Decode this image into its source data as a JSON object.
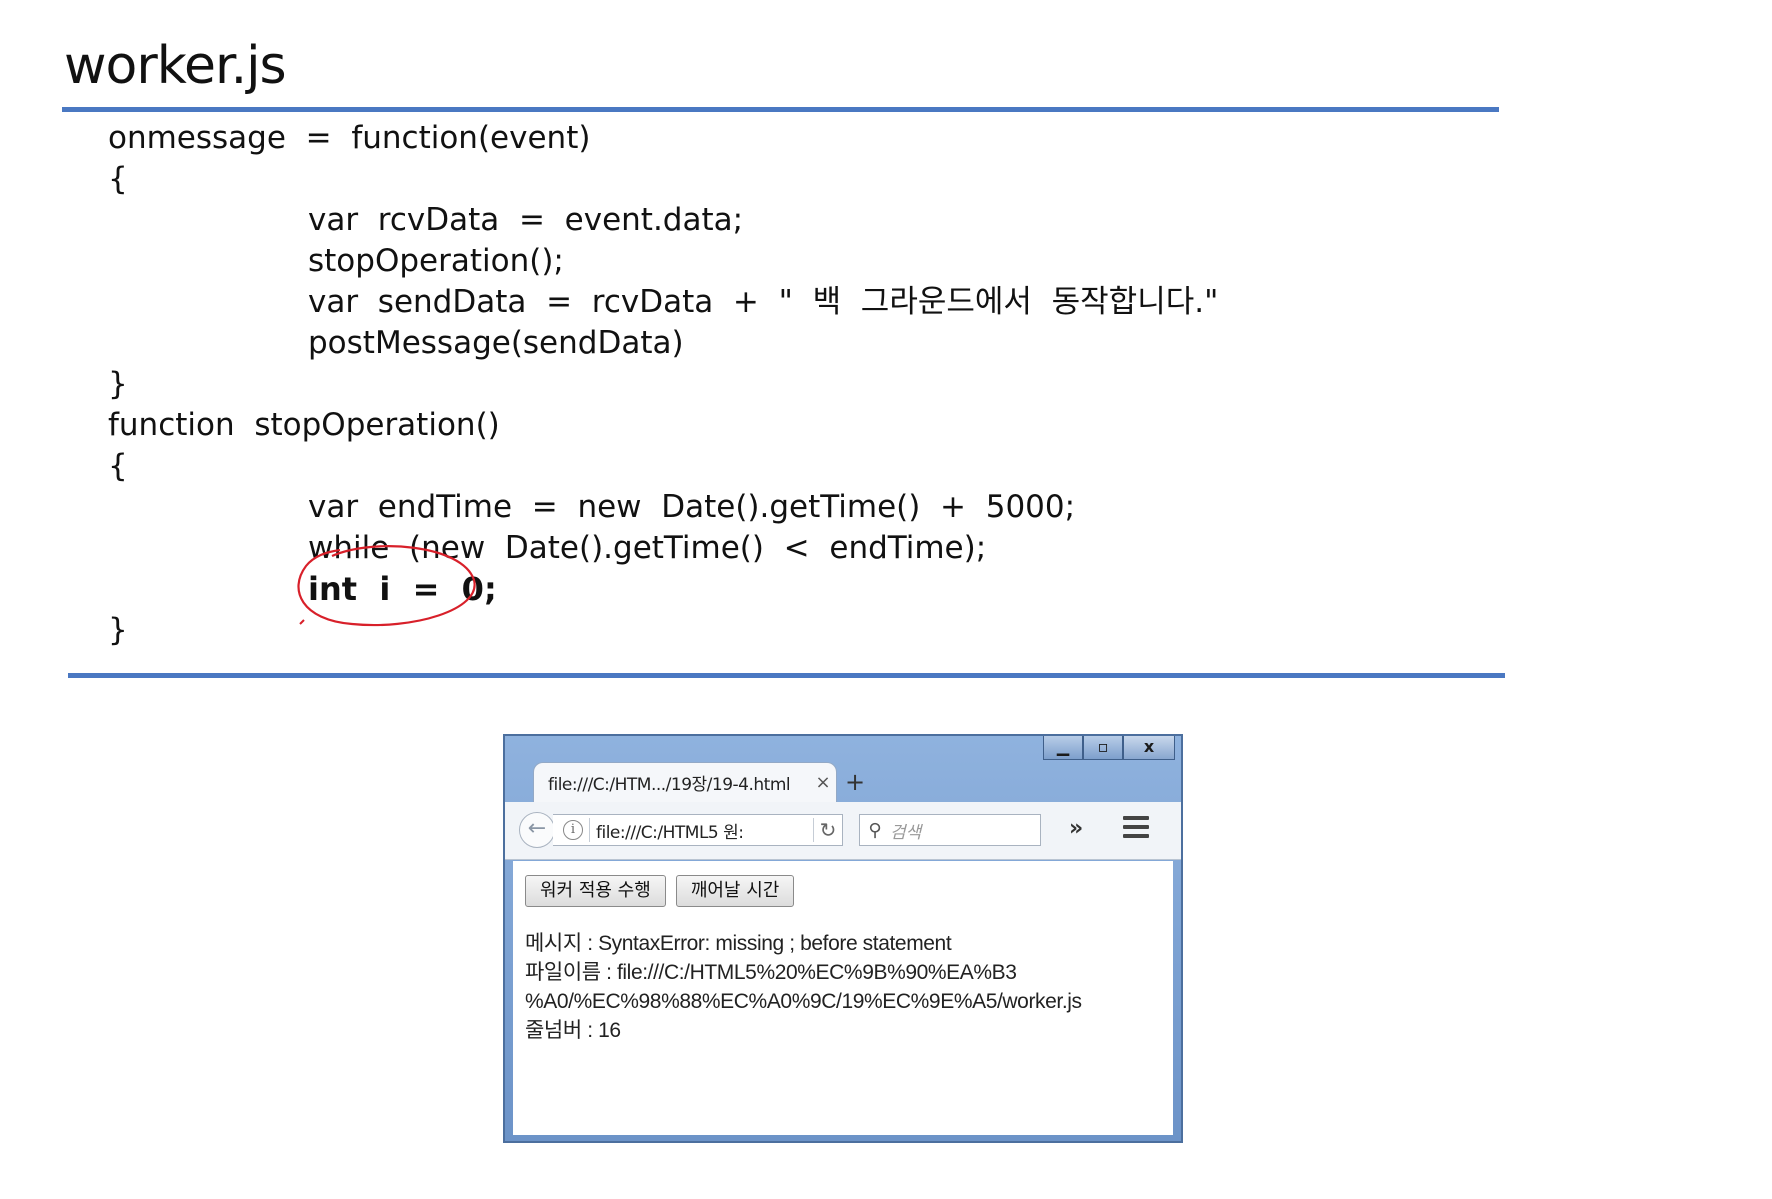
{
  "slide": {
    "title": "worker.js"
  },
  "code": {
    "lines": [
      "onmessage  =  function(event)",
      "{",
      "var  rcvData  =  event.data;",
      "stopOperation();",
      "var  sendData  =  rcvData  +  \"  백  그라운드에서  동작합니다.\"",
      "postMessage(sendData)",
      "}",
      "function  stopOperation()",
      "{",
      "var  endTime  =  new  Date().getTime()  +  5000;",
      "while  (new  Date().getTime()  <  endTime);",
      "int  i  =  0;",
      "}"
    ]
  },
  "browser": {
    "tab_title": "file:///C:/HTM.../19장/19-4.html",
    "tab_close": "×",
    "new_tab": "+",
    "url": "file:///C:/HTML5 원:",
    "search_placeholder": "검색",
    "overflow": "»",
    "window_controls": {
      "minimize": "▁",
      "maximize": "▫",
      "close": "x"
    },
    "buttons": {
      "run_worker": "워커 적용 수행",
      "wake_time": "깨어날 시간"
    },
    "messages": [
      "메시지 : SyntaxError: missing ; before statement",
      "파일이름 : file:///C:/HTML5%20%EC%9B%90%EA%B3",
      "%A0/%EC%98%88%EC%A0%9C/19%EC%9E%A5/worker.js",
      "줄넘버 : 16"
    ]
  },
  "colors": {
    "rule": "#4a78c2",
    "annotation": "#d8202a",
    "window_frame": "#6c93c8"
  }
}
